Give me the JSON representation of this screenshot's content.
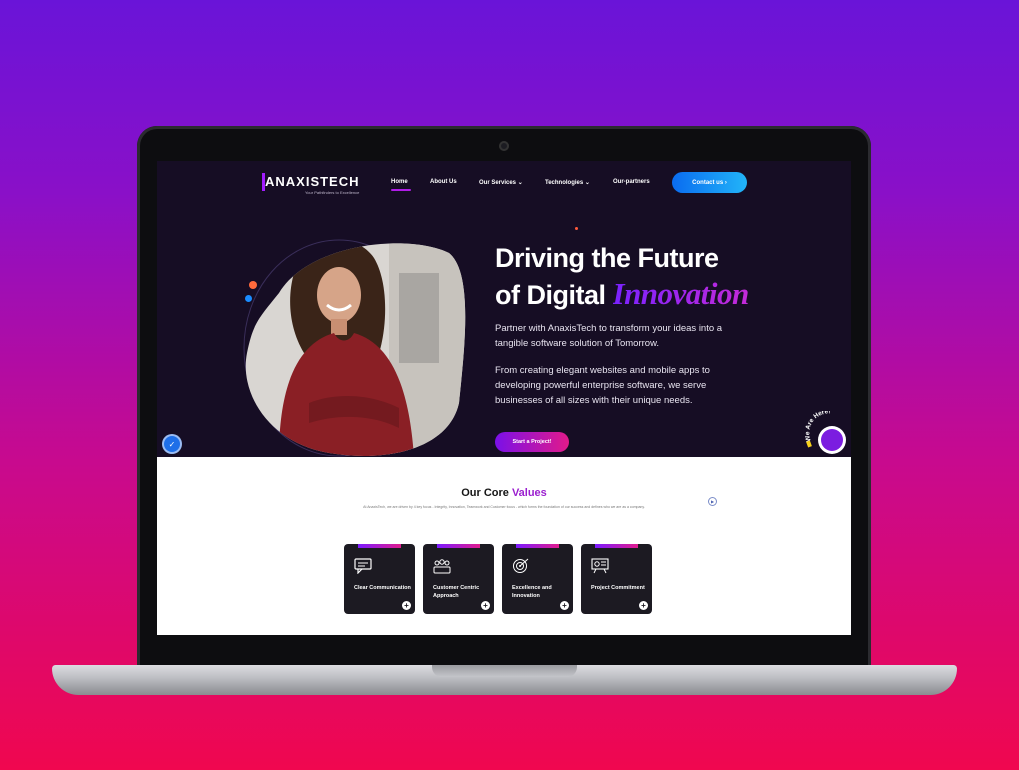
{
  "brand": {
    "name": "ANAXISTECH",
    "tagline": "Your Pathfinders to Excellence"
  },
  "nav": {
    "items": [
      {
        "label": "Home",
        "active": true
      },
      {
        "label": "About Us"
      },
      {
        "label": "Our Services ⌄"
      },
      {
        "label": "Technologies ⌄"
      },
      {
        "label": "Our-partners"
      }
    ],
    "contact_label": "Contact us  ›"
  },
  "hero": {
    "title_line1": "Driving the Future",
    "title_line2_prefix": "of Digital ",
    "title_line2_accent": "Innovation",
    "paragraph1": "Partner with AnaxisTech to transform your ideas into a tangible software solution of Tomorrow.",
    "paragraph2": "From creating elegant websites and mobile apps to developing powerful enterprise software, we serve businesses of all sizes with their unique needs.",
    "cta_label": "Start a Project!",
    "badge_text": "We Are Here!"
  },
  "values": {
    "title_prefix": "Our Core ",
    "title_accent": "Values",
    "subtitle": "At AnaxisTech, we are driven by 4 key focus - Integrity, Innovation, Teamwork and Customer focus - which forms the foundation of our success and defines who we are as a company.",
    "cards": [
      {
        "label": "Clear Communication",
        "icon": "chat-icon"
      },
      {
        "label": "Customer Centric Approach",
        "icon": "people-icon"
      },
      {
        "label": "Excellence and Innovation",
        "icon": "target-icon"
      },
      {
        "label": "Project Commitment",
        "icon": "presentation-icon"
      }
    ]
  },
  "colors": {
    "hero_bg": "#160d24",
    "accent_purple": "#9b1fcf",
    "contact_blue": "#0a6cf0",
    "cta_pink": "#e21a8a"
  }
}
